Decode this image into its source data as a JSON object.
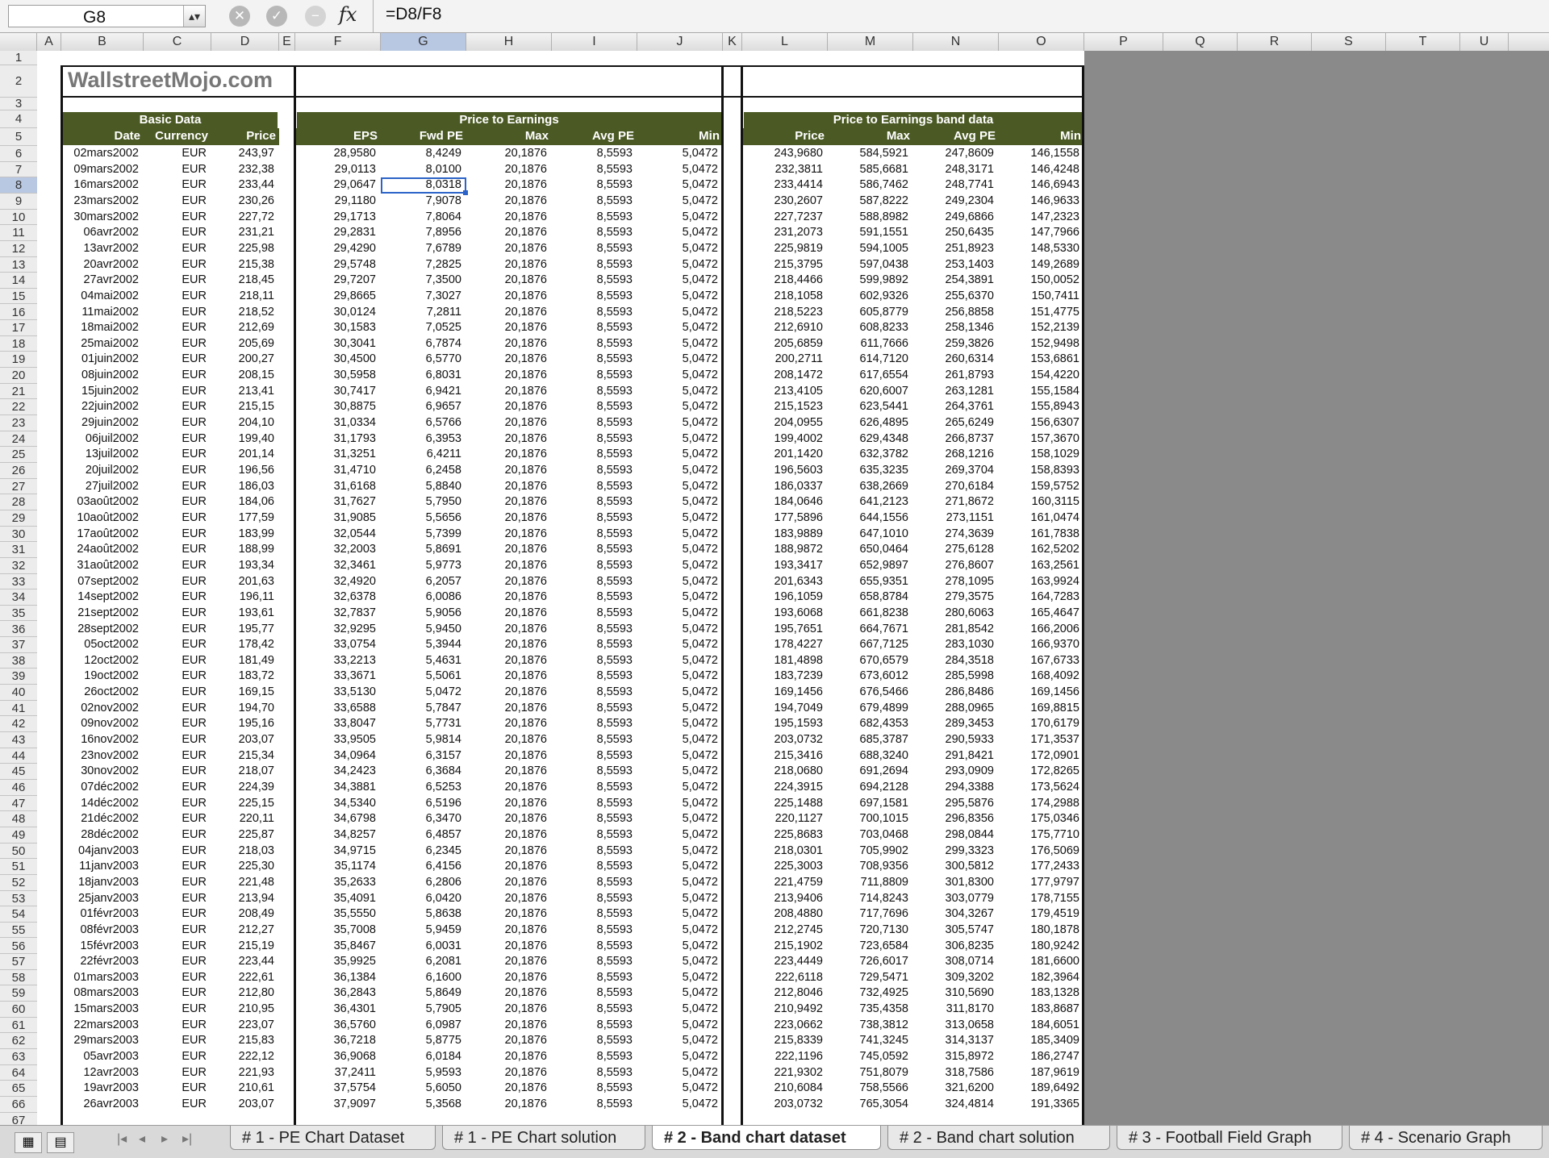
{
  "name_box": "G8",
  "formula": "=D8/F8",
  "fx_label": "fx",
  "columns": [
    "A",
    "B",
    "C",
    "D",
    "E",
    "F",
    "G",
    "H",
    "I",
    "J",
    "K",
    "L",
    "M",
    "N",
    "O",
    "P",
    "Q",
    "R",
    "S",
    "T",
    "U"
  ],
  "selected_column": "G",
  "selected_row": 8,
  "first_row": 1,
  "last_row": 67,
  "title": "WallstreetMojo.com",
  "groups": {
    "basic": "Basic Data",
    "pe": "Price to Earnings",
    "band": "Price to Earnings band data"
  },
  "headers": [
    "Date",
    "Currency",
    "Price",
    "EPS",
    "Fwd PE",
    "Max",
    "Avg PE",
    "Min",
    "Price",
    "Max",
    "Avg PE",
    "Min"
  ],
  "rows": [
    [
      "02mars2002",
      "EUR",
      "243,97",
      "28,9580",
      "8,4249",
      "20,1876",
      "8,5593",
      "5,0472",
      "243,9680",
      "584,5921",
      "247,8609",
      "146,1558"
    ],
    [
      "09mars2002",
      "EUR",
      "232,38",
      "29,0113",
      "8,0100",
      "20,1876",
      "8,5593",
      "5,0472",
      "232,3811",
      "585,6681",
      "248,3171",
      "146,4248"
    ],
    [
      "16mars2002",
      "EUR",
      "233,44",
      "29,0647",
      "8,0318",
      "20,1876",
      "8,5593",
      "5,0472",
      "233,4414",
      "586,7462",
      "248,7741",
      "146,6943"
    ],
    [
      "23mars2002",
      "EUR",
      "230,26",
      "29,1180",
      "7,9078",
      "20,1876",
      "8,5593",
      "5,0472",
      "230,2607",
      "587,8222",
      "249,2304",
      "146,9633"
    ],
    [
      "30mars2002",
      "EUR",
      "227,72",
      "29,1713",
      "7,8064",
      "20,1876",
      "8,5593",
      "5,0472",
      "227,7237",
      "588,8982",
      "249,6866",
      "147,2323"
    ],
    [
      "06avr2002",
      "EUR",
      "231,21",
      "29,2831",
      "7,8956",
      "20,1876",
      "8,5593",
      "5,0472",
      "231,2073",
      "591,1551",
      "250,6435",
      "147,7966"
    ],
    [
      "13avr2002",
      "EUR",
      "225,98",
      "29,4290",
      "7,6789",
      "20,1876",
      "8,5593",
      "5,0472",
      "225,9819",
      "594,1005",
      "251,8923",
      "148,5330"
    ],
    [
      "20avr2002",
      "EUR",
      "215,38",
      "29,5748",
      "7,2825",
      "20,1876",
      "8,5593",
      "5,0472",
      "215,3795",
      "597,0438",
      "253,1403",
      "149,2689"
    ],
    [
      "27avr2002",
      "EUR",
      "218,45",
      "29,7207",
      "7,3500",
      "20,1876",
      "8,5593",
      "5,0472",
      "218,4466",
      "599,9892",
      "254,3891",
      "150,0052"
    ],
    [
      "04mai2002",
      "EUR",
      "218,11",
      "29,8665",
      "7,3027",
      "20,1876",
      "8,5593",
      "5,0472",
      "218,1058",
      "602,9326",
      "255,6370",
      "150,7411"
    ],
    [
      "11mai2002",
      "EUR",
      "218,52",
      "30,0124",
      "7,2811",
      "20,1876",
      "8,5593",
      "5,0472",
      "218,5223",
      "605,8779",
      "256,8858",
      "151,4775"
    ],
    [
      "18mai2002",
      "EUR",
      "212,69",
      "30,1583",
      "7,0525",
      "20,1876",
      "8,5593",
      "5,0472",
      "212,6910",
      "608,8233",
      "258,1346",
      "152,2139"
    ],
    [
      "25mai2002",
      "EUR",
      "205,69",
      "30,3041",
      "6,7874",
      "20,1876",
      "8,5593",
      "5,0472",
      "205,6859",
      "611,7666",
      "259,3826",
      "152,9498"
    ],
    [
      "01juin2002",
      "EUR",
      "200,27",
      "30,4500",
      "6,5770",
      "20,1876",
      "8,5593",
      "5,0472",
      "200,2711",
      "614,7120",
      "260,6314",
      "153,6861"
    ],
    [
      "08juin2002",
      "EUR",
      "208,15",
      "30,5958",
      "6,8031",
      "20,1876",
      "8,5593",
      "5,0472",
      "208,1472",
      "617,6554",
      "261,8793",
      "154,4220"
    ],
    [
      "15juin2002",
      "EUR",
      "213,41",
      "30,7417",
      "6,9421",
      "20,1876",
      "8,5593",
      "5,0472",
      "213,4105",
      "620,6007",
      "263,1281",
      "155,1584"
    ],
    [
      "22juin2002",
      "EUR",
      "215,15",
      "30,8875",
      "6,9657",
      "20,1876",
      "8,5593",
      "5,0472",
      "215,1523",
      "623,5441",
      "264,3761",
      "155,8943"
    ],
    [
      "29juin2002",
      "EUR",
      "204,10",
      "31,0334",
      "6,5766",
      "20,1876",
      "8,5593",
      "5,0472",
      "204,0955",
      "626,4895",
      "265,6249",
      "156,6307"
    ],
    [
      "06juil2002",
      "EUR",
      "199,40",
      "31,1793",
      "6,3953",
      "20,1876",
      "8,5593",
      "5,0472",
      "199,4002",
      "629,4348",
      "266,8737",
      "157,3670"
    ],
    [
      "13juil2002",
      "EUR",
      "201,14",
      "31,3251",
      "6,4211",
      "20,1876",
      "8,5593",
      "5,0472",
      "201,1420",
      "632,3782",
      "268,1216",
      "158,1029"
    ],
    [
      "20juil2002",
      "EUR",
      "196,56",
      "31,4710",
      "6,2458",
      "20,1876",
      "8,5593",
      "5,0472",
      "196,5603",
      "635,3235",
      "269,3704",
      "158,8393"
    ],
    [
      "27juil2002",
      "EUR",
      "186,03",
      "31,6168",
      "5,8840",
      "20,1876",
      "8,5593",
      "5,0472",
      "186,0337",
      "638,2669",
      "270,6184",
      "159,5752"
    ],
    [
      "03août2002",
      "EUR",
      "184,06",
      "31,7627",
      "5,7950",
      "20,1876",
      "8,5593",
      "5,0472",
      "184,0646",
      "641,2123",
      "271,8672",
      "160,3115"
    ],
    [
      "10août2002",
      "EUR",
      "177,59",
      "31,9085",
      "5,5656",
      "20,1876",
      "8,5593",
      "5,0472",
      "177,5896",
      "644,1556",
      "273,1151",
      "161,0474"
    ],
    [
      "17août2002",
      "EUR",
      "183,99",
      "32,0544",
      "5,7399",
      "20,1876",
      "8,5593",
      "5,0472",
      "183,9889",
      "647,1010",
      "274,3639",
      "161,7838"
    ],
    [
      "24août2002",
      "EUR",
      "188,99",
      "32,2003",
      "5,8691",
      "20,1876",
      "8,5593",
      "5,0472",
      "188,9872",
      "650,0464",
      "275,6128",
      "162,5202"
    ],
    [
      "31août2002",
      "EUR",
      "193,34",
      "32,3461",
      "5,9773",
      "20,1876",
      "8,5593",
      "5,0472",
      "193,3417",
      "652,9897",
      "276,8607",
      "163,2561"
    ],
    [
      "07sept2002",
      "EUR",
      "201,63",
      "32,4920",
      "6,2057",
      "20,1876",
      "8,5593",
      "5,0472",
      "201,6343",
      "655,9351",
      "278,1095",
      "163,9924"
    ],
    [
      "14sept2002",
      "EUR",
      "196,11",
      "32,6378",
      "6,0086",
      "20,1876",
      "8,5593",
      "5,0472",
      "196,1059",
      "658,8784",
      "279,3575",
      "164,7283"
    ],
    [
      "21sept2002",
      "EUR",
      "193,61",
      "32,7837",
      "5,9056",
      "20,1876",
      "8,5593",
      "5,0472",
      "193,6068",
      "661,8238",
      "280,6063",
      "165,4647"
    ],
    [
      "28sept2002",
      "EUR",
      "195,77",
      "32,9295",
      "5,9450",
      "20,1876",
      "8,5593",
      "5,0472",
      "195,7651",
      "664,7671",
      "281,8542",
      "166,2006"
    ],
    [
      "05oct2002",
      "EUR",
      "178,42",
      "33,0754",
      "5,3944",
      "20,1876",
      "8,5593",
      "5,0472",
      "178,4227",
      "667,7125",
      "283,1030",
      "166,9370"
    ],
    [
      "12oct2002",
      "EUR",
      "181,49",
      "33,2213",
      "5,4631",
      "20,1876",
      "8,5593",
      "5,0472",
      "181,4898",
      "670,6579",
      "284,3518",
      "167,6733"
    ],
    [
      "19oct2002",
      "EUR",
      "183,72",
      "33,3671",
      "5,5061",
      "20,1876",
      "8,5593",
      "5,0472",
      "183,7239",
      "673,6012",
      "285,5998",
      "168,4092"
    ],
    [
      "26oct2002",
      "EUR",
      "169,15",
      "33,5130",
      "5,0472",
      "20,1876",
      "8,5593",
      "5,0472",
      "169,1456",
      "676,5466",
      "286,8486",
      "169,1456"
    ],
    [
      "02nov2002",
      "EUR",
      "194,70",
      "33,6588",
      "5,7847",
      "20,1876",
      "8,5593",
      "5,0472",
      "194,7049",
      "679,4899",
      "288,0965",
      "169,8815"
    ],
    [
      "09nov2002",
      "EUR",
      "195,16",
      "33,8047",
      "5,7731",
      "20,1876",
      "8,5593",
      "5,0472",
      "195,1593",
      "682,4353",
      "289,3453",
      "170,6179"
    ],
    [
      "16nov2002",
      "EUR",
      "203,07",
      "33,9505",
      "5,9814",
      "20,1876",
      "8,5593",
      "5,0472",
      "203,0732",
      "685,3787",
      "290,5933",
      "171,3537"
    ],
    [
      "23nov2002",
      "EUR",
      "215,34",
      "34,0964",
      "6,3157",
      "20,1876",
      "8,5593",
      "5,0472",
      "215,3416",
      "688,3240",
      "291,8421",
      "172,0901"
    ],
    [
      "30nov2002",
      "EUR",
      "218,07",
      "34,2423",
      "6,3684",
      "20,1876",
      "8,5593",
      "5,0472",
      "218,0680",
      "691,2694",
      "293,0909",
      "172,8265"
    ],
    [
      "07déc2002",
      "EUR",
      "224,39",
      "34,3881",
      "6,5253",
      "20,1876",
      "8,5593",
      "5,0472",
      "224,3915",
      "694,2128",
      "294,3388",
      "173,5624"
    ],
    [
      "14déc2002",
      "EUR",
      "225,15",
      "34,5340",
      "6,5196",
      "20,1876",
      "8,5593",
      "5,0472",
      "225,1488",
      "697,1581",
      "295,5876",
      "174,2988"
    ],
    [
      "21déc2002",
      "EUR",
      "220,11",
      "34,6798",
      "6,3470",
      "20,1876",
      "8,5593",
      "5,0472",
      "220,1127",
      "700,1015",
      "296,8356",
      "175,0346"
    ],
    [
      "28déc2002",
      "EUR",
      "225,87",
      "34,8257",
      "6,4857",
      "20,1876",
      "8,5593",
      "5,0472",
      "225,8683",
      "703,0468",
      "298,0844",
      "175,7710"
    ],
    [
      "04janv2003",
      "EUR",
      "218,03",
      "34,9715",
      "6,2345",
      "20,1876",
      "8,5593",
      "5,0472",
      "218,0301",
      "705,9902",
      "299,3323",
      "176,5069"
    ],
    [
      "11janv2003",
      "EUR",
      "225,30",
      "35,1174",
      "6,4156",
      "20,1876",
      "8,5593",
      "5,0472",
      "225,3003",
      "708,9356",
      "300,5812",
      "177,2433"
    ],
    [
      "18janv2003",
      "EUR",
      "221,48",
      "35,2633",
      "6,2806",
      "20,1876",
      "8,5593",
      "5,0472",
      "221,4759",
      "711,8809",
      "301,8300",
      "177,9797"
    ],
    [
      "25janv2003",
      "EUR",
      "213,94",
      "35,4091",
      "6,0420",
      "20,1876",
      "8,5593",
      "5,0472",
      "213,9406",
      "714,8243",
      "303,0779",
      "178,7155"
    ],
    [
      "01févr2003",
      "EUR",
      "208,49",
      "35,5550",
      "5,8638",
      "20,1876",
      "8,5593",
      "5,0472",
      "208,4880",
      "717,7696",
      "304,3267",
      "179,4519"
    ],
    [
      "08févr2003",
      "EUR",
      "212,27",
      "35,7008",
      "5,9459",
      "20,1876",
      "8,5593",
      "5,0472",
      "212,2745",
      "720,7130",
      "305,5747",
      "180,1878"
    ],
    [
      "15févr2003",
      "EUR",
      "215,19",
      "35,8467",
      "6,0031",
      "20,1876",
      "8,5593",
      "5,0472",
      "215,1902",
      "723,6584",
      "306,8235",
      "180,9242"
    ],
    [
      "22févr2003",
      "EUR",
      "223,44",
      "35,9925",
      "6,2081",
      "20,1876",
      "8,5593",
      "5,0472",
      "223,4449",
      "726,6017",
      "308,0714",
      "181,6600"
    ],
    [
      "01mars2003",
      "EUR",
      "222,61",
      "36,1384",
      "6,1600",
      "20,1876",
      "8,5593",
      "5,0472",
      "222,6118",
      "729,5471",
      "309,3202",
      "182,3964"
    ],
    [
      "08mars2003",
      "EUR",
      "212,80",
      "36,2843",
      "5,8649",
      "20,1876",
      "8,5593",
      "5,0472",
      "212,8046",
      "732,4925",
      "310,5690",
      "183,1328"
    ],
    [
      "15mars2003",
      "EUR",
      "210,95",
      "36,4301",
      "5,7905",
      "20,1876",
      "8,5593",
      "5,0472",
      "210,9492",
      "735,4358",
      "311,8170",
      "183,8687"
    ],
    [
      "22mars2003",
      "EUR",
      "223,07",
      "36,5760",
      "6,0987",
      "20,1876",
      "8,5593",
      "5,0472",
      "223,0662",
      "738,3812",
      "313,0658",
      "184,6051"
    ],
    [
      "29mars2003",
      "EUR",
      "215,83",
      "36,7218",
      "5,8775",
      "20,1876",
      "8,5593",
      "5,0472",
      "215,8339",
      "741,3245",
      "314,3137",
      "185,3409"
    ],
    [
      "05avr2003",
      "EUR",
      "222,12",
      "36,9068",
      "6,0184",
      "20,1876",
      "8,5593",
      "5,0472",
      "222,1196",
      "745,0592",
      "315,8972",
      "186,2747"
    ],
    [
      "12avr2003",
      "EUR",
      "221,93",
      "37,2411",
      "5,9593",
      "20,1876",
      "8,5593",
      "5,0472",
      "221,9302",
      "751,8079",
      "318,7586",
      "187,9619"
    ],
    [
      "19avr2003",
      "EUR",
      "210,61",
      "37,5754",
      "5,6050",
      "20,1876",
      "8,5593",
      "5,0472",
      "210,6084",
      "758,5566",
      "321,6200",
      "189,6492"
    ],
    [
      "26avr2003",
      "EUR",
      "203,07",
      "37,9097",
      "5,3568",
      "20,1876",
      "8,5593",
      "5,0472",
      "203,0732",
      "765,3054",
      "324,4814",
      "191,3365"
    ]
  ],
  "tabs": [
    "# 1 - PE Chart Dataset",
    "# 1 - PE Chart solution",
    "# 2 - Band chart dataset",
    "# 2 - Band chart solution",
    "# 3 - Football Field Graph",
    "# 4 - Scenario Graph"
  ],
  "active_tab": "# 2 - Band chart dataset"
}
